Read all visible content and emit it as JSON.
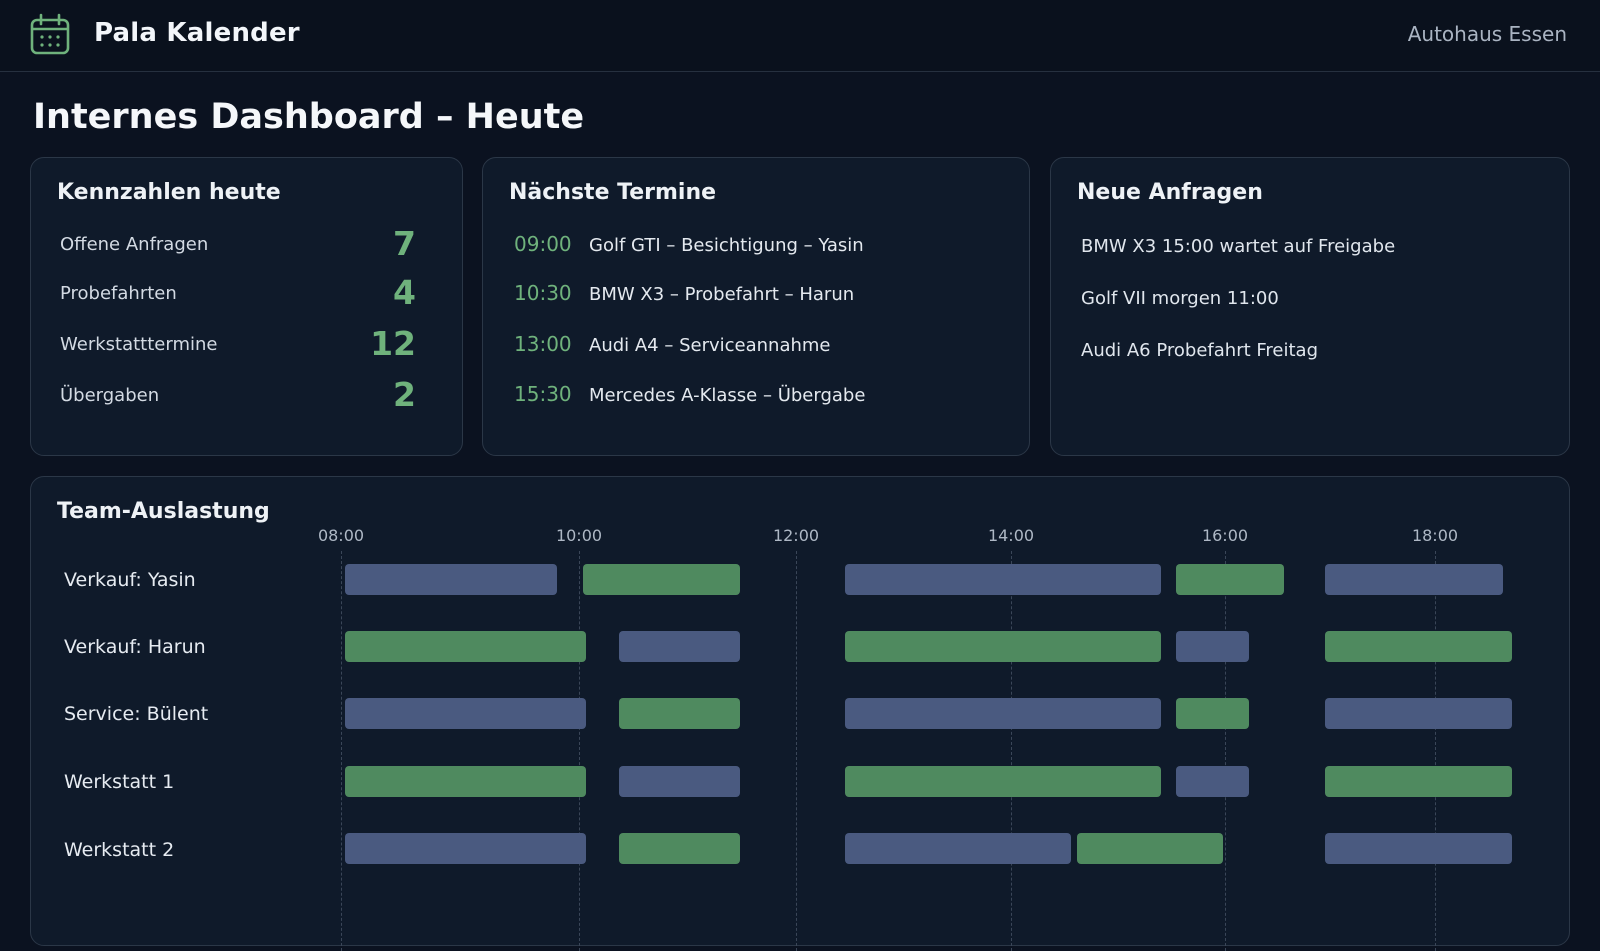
{
  "header": {
    "app_title": "Pala Kalender",
    "company": "Autohaus Essen",
    "logo_icon": "calendar-icon",
    "accent_color": "#6fb27c"
  },
  "page": {
    "title": "Internes Dashboard – Heute"
  },
  "kpis": {
    "title": "Kennzahlen heute",
    "items": [
      {
        "label": "Offene Anfragen",
        "value": "7"
      },
      {
        "label": "Probefahrten",
        "value": "4"
      },
      {
        "label": "Werkstatttermine",
        "value": "12"
      },
      {
        "label": "Übergaben",
        "value": "2"
      }
    ]
  },
  "appointments": {
    "title": "Nächste Termine",
    "items": [
      {
        "time": "09:00",
        "text": "Golf GTI – Besichtigung – Yasin"
      },
      {
        "time": "10:30",
        "text": "BMW X3 – Probefahrt – Harun"
      },
      {
        "time": "13:00",
        "text": "Audi A4 – Serviceannahme"
      },
      {
        "time": "15:30",
        "text": "Mercedes A-Klasse – Übergabe"
      }
    ]
  },
  "requests": {
    "title": "Neue Anfragen",
    "items": [
      "BMW X3 15:00 wartet auf Freigabe",
      "Golf VII morgen 11:00",
      "Audi A6 Probefahrt Freitag"
    ]
  },
  "team": {
    "title": "Team-Auslastung",
    "ticks": [
      "08:00",
      "10:00",
      "12:00",
      "14:00",
      "16:00",
      "18:00"
    ],
    "colors": {
      "busy": "#4a5a80",
      "free": "#4f8a5f"
    },
    "rows": [
      {
        "name": "Verkauf: Yasin",
        "blocks": [
          {
            "start": "08:00",
            "end": "09:50",
            "kind": "busy"
          },
          {
            "start": "10:00",
            "end": "11:30",
            "kind": "free"
          },
          {
            "start": "12:25",
            "end": "15:25",
            "kind": "busy"
          },
          {
            "start": "15:30",
            "end": "16:35",
            "kind": "free"
          },
          {
            "start": "16:55",
            "end": "18:40",
            "kind": "busy"
          }
        ]
      },
      {
        "name": "Verkauf: Harun",
        "blocks": [
          {
            "start": "08:00",
            "end": "10:05",
            "kind": "free"
          },
          {
            "start": "10:20",
            "end": "11:30",
            "kind": "busy"
          },
          {
            "start": "12:25",
            "end": "15:25",
            "kind": "free"
          },
          {
            "start": "15:30",
            "end": "16:15",
            "kind": "busy"
          },
          {
            "start": "16:55",
            "end": "18:45",
            "kind": "free"
          }
        ]
      },
      {
        "name": "Service: Bülent",
        "blocks": [
          {
            "start": "08:00",
            "end": "10:05",
            "kind": "busy"
          },
          {
            "start": "10:20",
            "end": "11:30",
            "kind": "free"
          },
          {
            "start": "12:25",
            "end": "15:25",
            "kind": "busy"
          },
          {
            "start": "15:30",
            "end": "16:15",
            "kind": "free"
          },
          {
            "start": "16:55",
            "end": "18:45",
            "kind": "busy"
          }
        ]
      },
      {
        "name": "Werkstatt 1",
        "blocks": [
          {
            "start": "08:00",
            "end": "10:05",
            "kind": "free"
          },
          {
            "start": "10:20",
            "end": "11:30",
            "kind": "busy"
          },
          {
            "start": "12:25",
            "end": "15:25",
            "kind": "free"
          },
          {
            "start": "15:30",
            "end": "16:15",
            "kind": "busy"
          },
          {
            "start": "16:55",
            "end": "18:45",
            "kind": "free"
          }
        ]
      },
      {
        "name": "Werkstatt 2",
        "blocks": [
          {
            "start": "08:00",
            "end": "10:05",
            "kind": "busy"
          },
          {
            "start": "10:20",
            "end": "11:30",
            "kind": "free"
          },
          {
            "start": "12:25",
            "end": "14:35",
            "kind": "busy"
          },
          {
            "start": "14:35",
            "end": "16:00",
            "kind": "free"
          },
          {
            "start": "16:55",
            "end": "18:45",
            "kind": "busy"
          }
        ]
      }
    ]
  }
}
